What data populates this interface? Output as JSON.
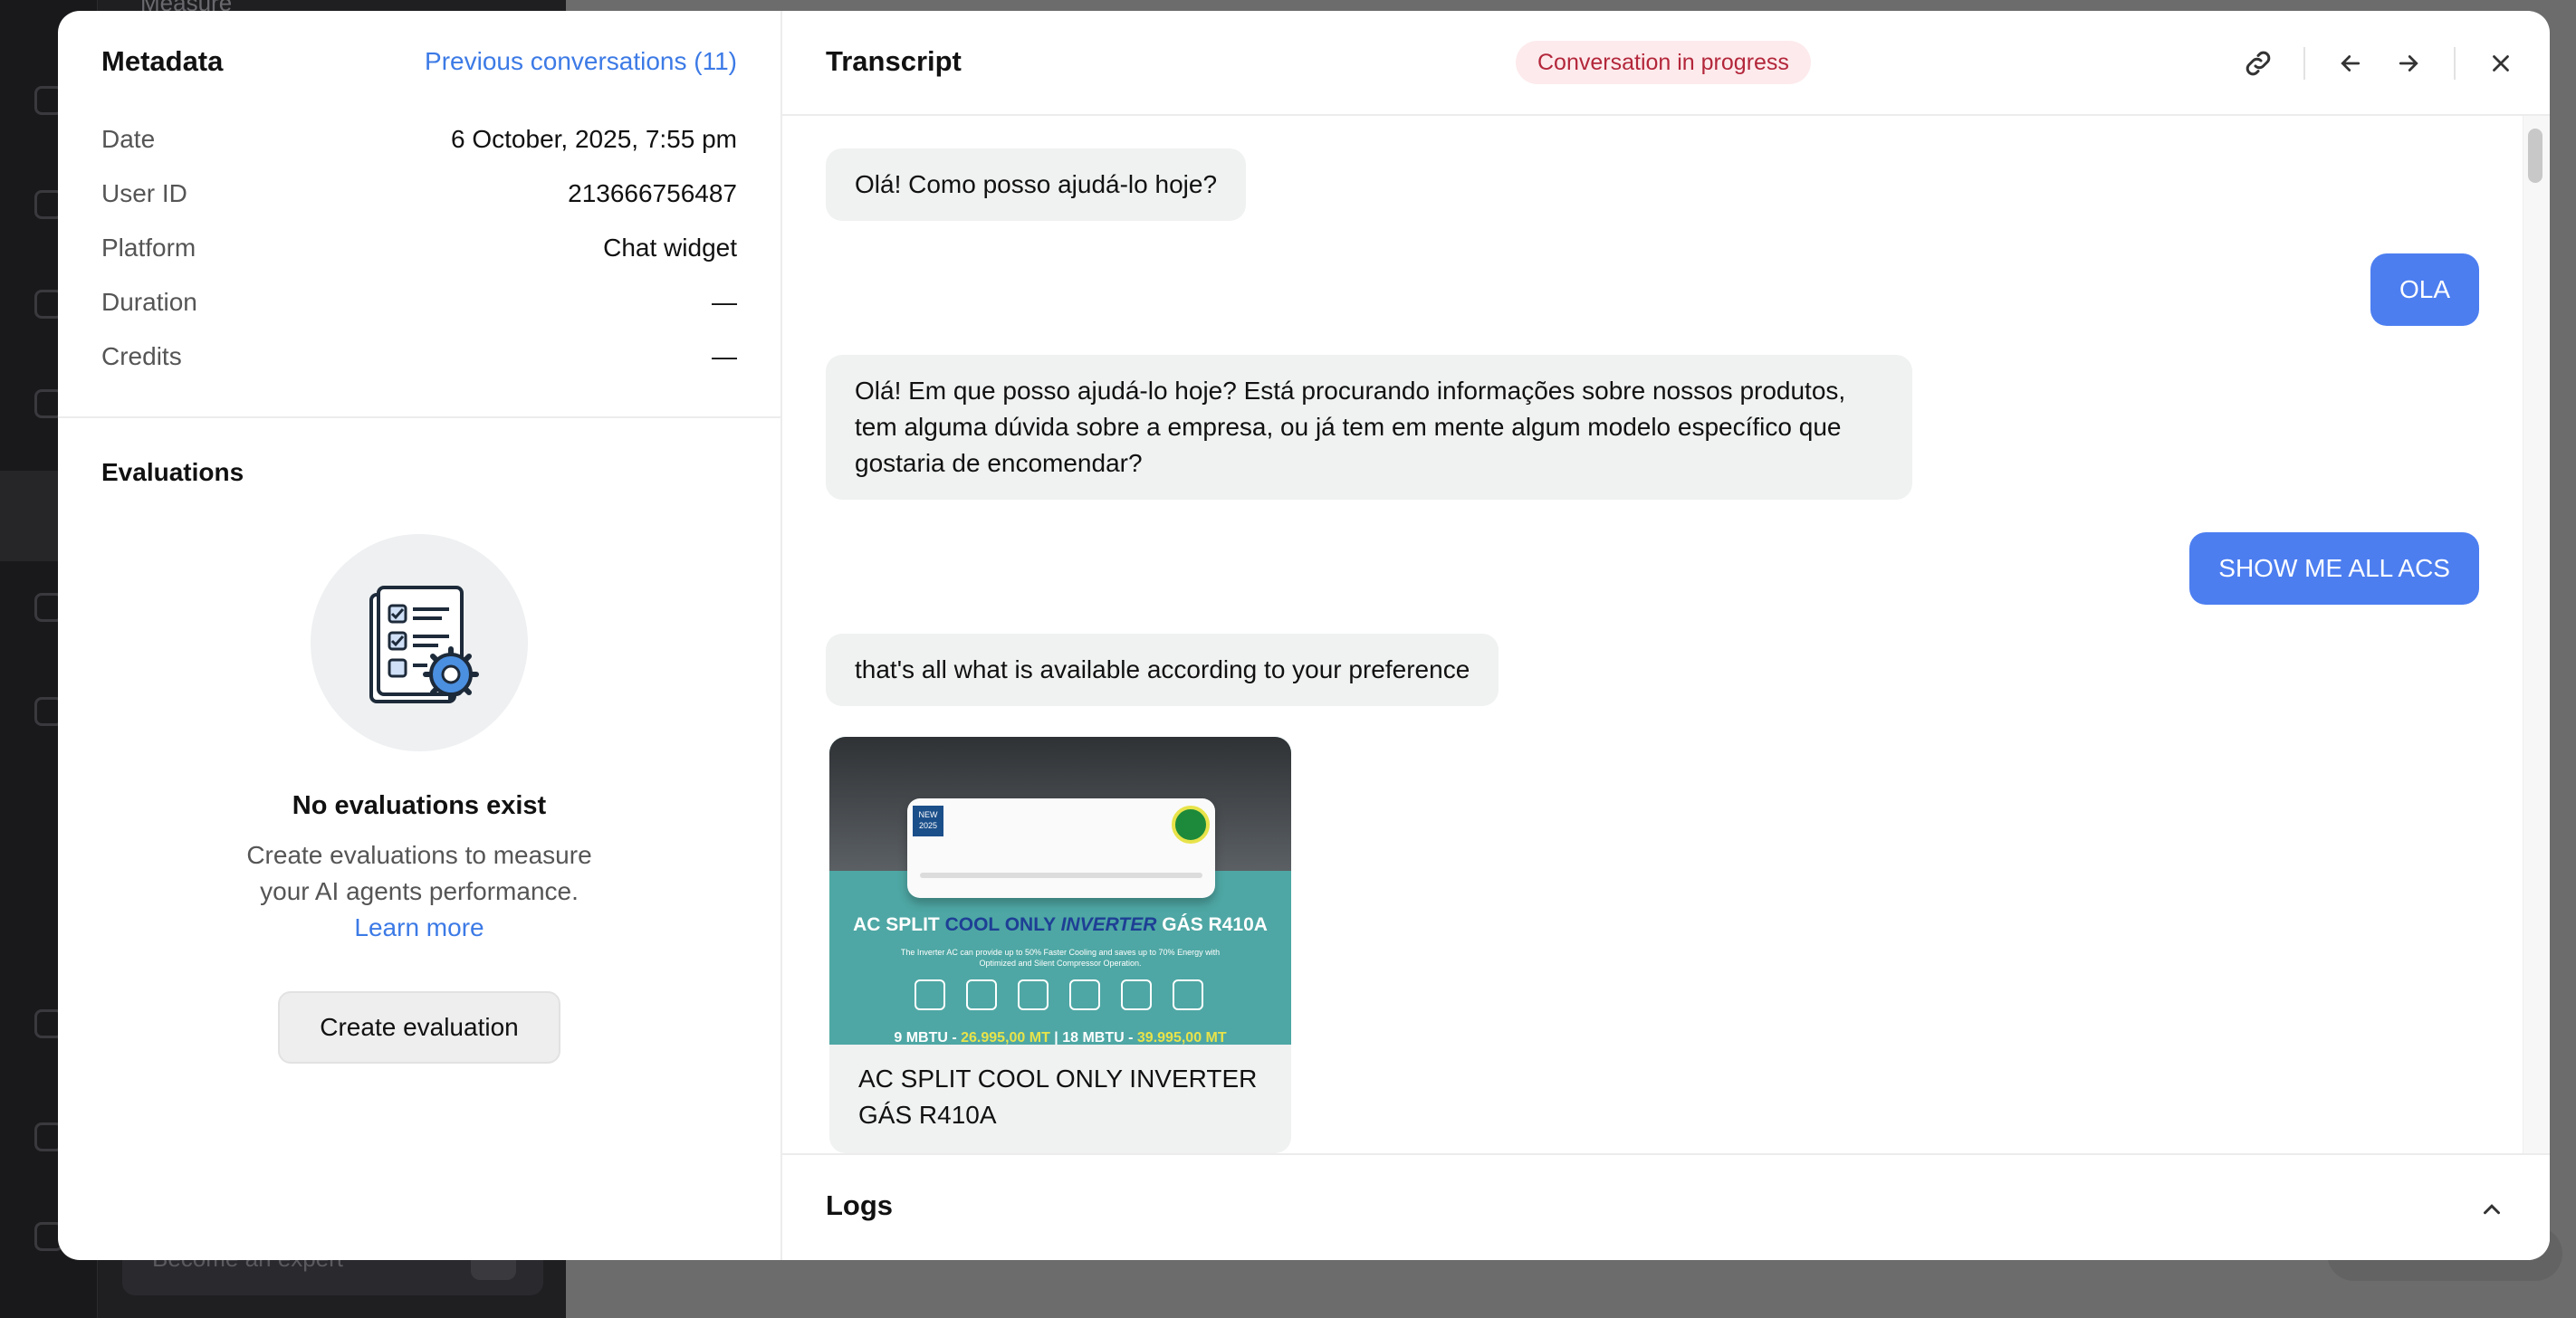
{
  "background": {
    "top_label": "Measure",
    "input_placeholder": "Become an expert"
  },
  "metadata": {
    "title": "Metadata",
    "previous_link": "Previous conversations (11)",
    "rows": [
      {
        "label": "Date",
        "value": "6 October, 2025, 7:55 pm"
      },
      {
        "label": "User ID",
        "value": "213666756487"
      },
      {
        "label": "Platform",
        "value": "Chat widget"
      },
      {
        "label": "Duration",
        "value": "—"
      },
      {
        "label": "Credits",
        "value": "—"
      }
    ]
  },
  "evaluations": {
    "title": "Evaluations",
    "empty_title": "No evaluations exist",
    "empty_desc": "Create evaluations to measure your AI agents performance.",
    "learn_more": "Learn more",
    "create_button": "Create evaluation"
  },
  "transcript": {
    "title": "Transcript",
    "status": "Conversation in progress",
    "messages": [
      {
        "role": "bot",
        "text": "Olá! Como posso ajudá-lo hoje?"
      },
      {
        "role": "user",
        "text": "OLA"
      },
      {
        "role": "bot",
        "text": "Olá! Em que posso ajudá-lo hoje? Está procurando informações sobre nossos produtos, tem alguma dúvida sobre a empresa, ou já tem em mente algum modelo específico que gostaria de encomendar?"
      },
      {
        "role": "user",
        "text": "SHOW ME ALL ACS"
      },
      {
        "role": "bot",
        "text": "that's all what is available according to your preference"
      }
    ],
    "product_card": {
      "title": "AC SPLIT COOL ONLY INVERTER GÁS R410A",
      "image_headline_a": "AC SPLIT ",
      "image_headline_b": "COOL ONLY ",
      "image_headline_c": "INVERTER",
      "image_headline_d": " GÁS R410A",
      "image_sub": "The Inverter AC can provide up to 50% Faster Cooling and saves up to 70% Energy with Optimized and Silent Compressor Operation.",
      "price_a_label": "9 MBTU - ",
      "price_a": "26.995,00 MT",
      "price_b_label": " | 18 MBTU - ",
      "price_b": "39.995,00 MT",
      "badge": "NEW 2025"
    }
  },
  "logs": {
    "title": "Logs"
  },
  "colors": {
    "accent": "#3c7ae6",
    "user_bubble": "#4c7ef0",
    "status_bg": "#fdeaec",
    "status_text": "#b3263a"
  }
}
